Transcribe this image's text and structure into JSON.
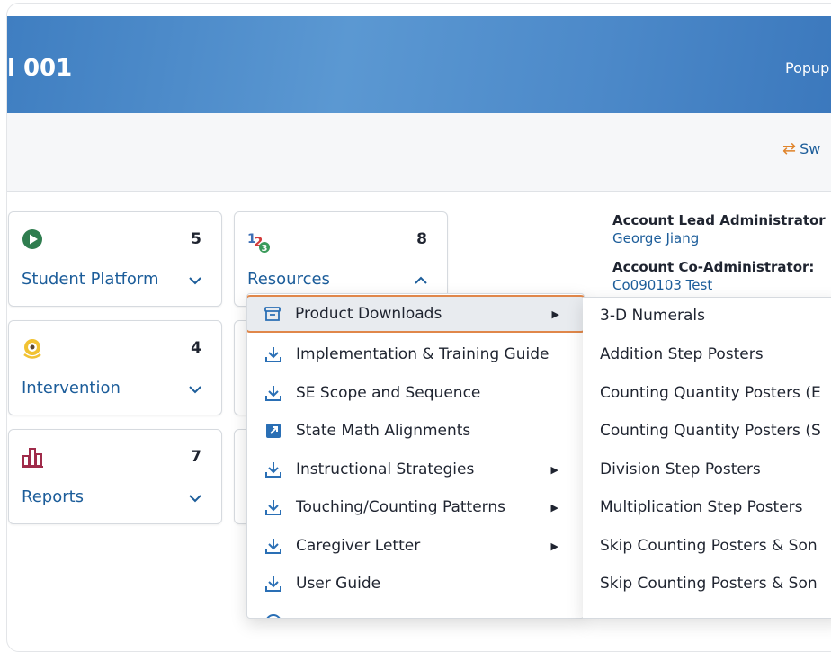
{
  "banner": {
    "title": "l 001",
    "right_text": "Popup"
  },
  "subbar": {
    "switch_label": "Sw"
  },
  "cards": [
    {
      "label": "Student Platform",
      "count": "5",
      "icon": "play-circle-icon",
      "chevron": "˅"
    },
    {
      "label": "Resources",
      "count": "8",
      "icon": "123-icon",
      "chevron": "˄"
    },
    {
      "label": "Intervention",
      "count": "4",
      "icon": "target-icon",
      "chevron": "˅"
    },
    {
      "label": "Reports",
      "count": "7",
      "icon": "bar-chart-icon",
      "chevron": "˅"
    }
  ],
  "admins": {
    "lead_title": "Account Lead Administrator",
    "lead_name": "George Jiang",
    "co_title": "Account Co-Administrator:",
    "co_name": "Co090103 Test"
  },
  "menu": {
    "items": [
      {
        "label": "Product Downloads",
        "icon": "archive-box-icon",
        "has_submenu": true,
        "active": true
      },
      {
        "label": "Implementation & Training Guide",
        "icon": "download-icon",
        "has_submenu": false
      },
      {
        "label": "SE Scope and Sequence",
        "icon": "download-icon",
        "has_submenu": false
      },
      {
        "label": "State Math Alignments",
        "icon": "external-link-icon",
        "has_submenu": false
      },
      {
        "label": "Instructional Strategies",
        "icon": "download-icon",
        "has_submenu": true
      },
      {
        "label": "Touching/Counting Patterns",
        "icon": "download-icon",
        "has_submenu": true
      },
      {
        "label": "Caregiver Letter",
        "icon": "download-icon",
        "has_submenu": true
      },
      {
        "label": "User Guide",
        "icon": "download-icon",
        "has_submenu": false
      }
    ]
  },
  "submenu": {
    "items": [
      "3-D Numerals",
      "Addition Step Posters",
      "Counting Quantity Posters (E",
      "Counting Quantity Posters (S",
      "Division Step Posters",
      "Multiplication Step Posters",
      "Skip Counting Posters & Son",
      "Skip Counting Posters & Son"
    ]
  },
  "colors": {
    "accent": "#1c5d9a",
    "highlight_border": "#e0874a",
    "banner": "#4c89c9"
  }
}
